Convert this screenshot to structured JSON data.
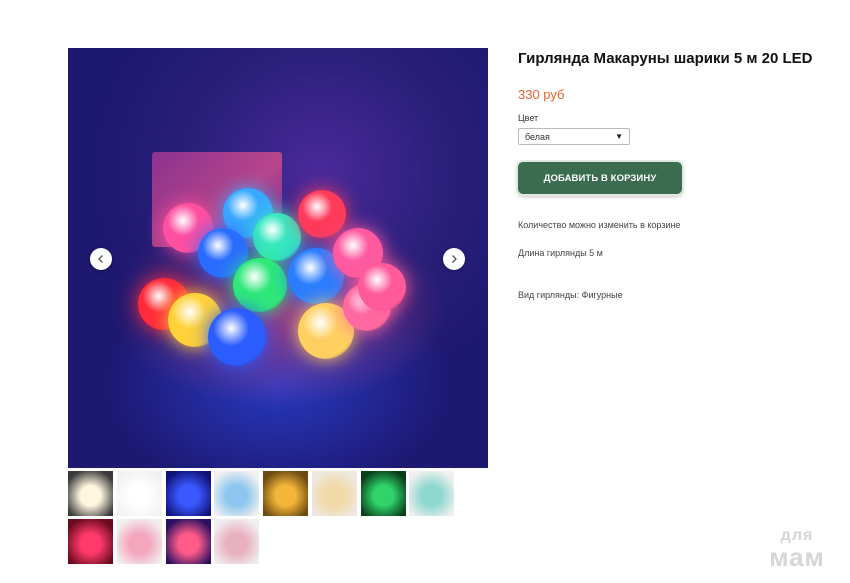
{
  "product": {
    "title": "Гирлянда Макаруны шарики 5 м 20 LED",
    "price": "330 руб",
    "color_label": "Цвет",
    "color_selected": "белая",
    "add_to_cart": "ДОБАВИТЬ В КОРЗИНУ",
    "notes": [
      "Количество можно изменить в корзине",
      "Длина гирлянды 5 м",
      "Вид гирлянды: Фигурные"
    ]
  },
  "gallery": {
    "thumbnails": [
      {
        "colors": [
          "#3a3a3a",
          "#fff6e0"
        ]
      },
      {
        "colors": [
          "#f1f1f1",
          "#ffffff"
        ]
      },
      {
        "colors": [
          "#10127a",
          "#3a58ff"
        ]
      },
      {
        "colors": [
          "#f0f0f0",
          "#8cc6ee"
        ]
      },
      {
        "colors": [
          "#6a4a10",
          "#f3b63a"
        ]
      },
      {
        "colors": [
          "#ede9e2",
          "#f2d9a8"
        ]
      },
      {
        "colors": [
          "#0a3d1a",
          "#2fd36a"
        ]
      },
      {
        "colors": [
          "#f0f0f0",
          "#8ed8d0"
        ]
      },
      {
        "colors": [
          "#6a0a1e",
          "#ff3a6a"
        ]
      },
      {
        "colors": [
          "#f2eeee",
          "#f4a6bf"
        ]
      },
      {
        "colors": [
          "#2a1060",
          "#ff5a8a"
        ]
      },
      {
        "colors": [
          "#efefef",
          "#e9b0c0"
        ]
      }
    ]
  },
  "watermark": {
    "line1": "для",
    "line2": "мам"
  },
  "icons": {
    "prev": "chevron-left-icon",
    "next": "chevron-right-icon"
  }
}
